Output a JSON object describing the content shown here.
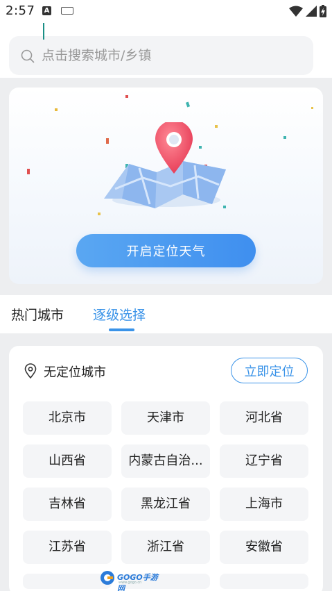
{
  "status_bar": {
    "time": "2:57",
    "notif_letter": "A"
  },
  "search": {
    "placeholder": "点击搜索城市/乡镇",
    "value": ""
  },
  "locate_card": {
    "button_label": "开启定位天气"
  },
  "tabs": [
    {
      "label": "热门城市",
      "active": false
    },
    {
      "label": "逐级选择",
      "active": true
    }
  ],
  "city_panel": {
    "no_location_text": "无定位城市",
    "locate_now_label": "立即定位",
    "cities": [
      "北京市",
      "天津市",
      "河北省",
      "山西省",
      "内蒙古自治...",
      "辽宁省",
      "吉林省",
      "黑龙江省",
      "上海市",
      "江苏省",
      "浙江省",
      "安徽省"
    ]
  },
  "watermark": {
    "text": "GOGO手游网",
    "sub": "www.gogo.cn"
  },
  "colors": {
    "accent": "#3a93e8",
    "pin": "#f0536b",
    "grey_bg": "#edeef0"
  }
}
